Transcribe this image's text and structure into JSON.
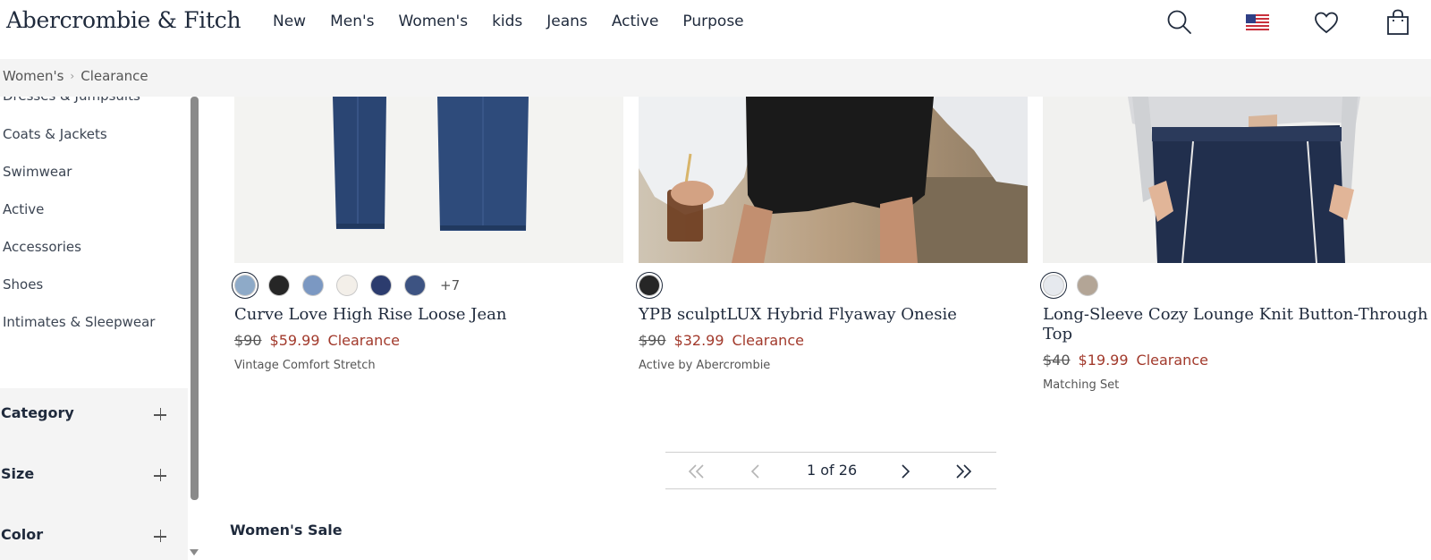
{
  "header": {
    "logo": "Abercrombie & Fitch",
    "nav": [
      "New",
      "Men's",
      "Women's",
      "kids",
      "Jeans",
      "Active",
      "Purpose"
    ],
    "icons": [
      "search-icon",
      "us-flag-icon",
      "wishlist-heart-icon",
      "shopping-bag-icon"
    ]
  },
  "breadcrumb": {
    "items": [
      "Women's",
      "Clearance"
    ],
    "separator": "›"
  },
  "sidebar": {
    "links": [
      "Dresses & Jumpsuits",
      "Coats & Jackets",
      "Swimwear",
      "Active",
      "Accessories",
      "Shoes",
      "Intimates & Sleepwear"
    ],
    "filters": [
      "Category",
      "Size",
      "Color"
    ]
  },
  "products": [
    {
      "name": "Curve Love High Rise Loose Jean",
      "price_original": "$90",
      "price_sale": "$59.99",
      "sale_label": "Clearance",
      "description": "Vintage Comfort Stretch",
      "swatch_colors": [
        "#8eaac8",
        "#262626",
        "#7b98c2",
        "#f3efe9",
        "#2c3c6e",
        "#3d5382"
      ],
      "swatch_more": "+7"
    },
    {
      "name": "YPB sculptLUX Hybrid Flyaway Onesie",
      "price_original": "$90",
      "price_sale": "$32.99",
      "sale_label": "Clearance",
      "description": "Active by Abercrombie",
      "swatch_colors": [
        "#262626"
      ]
    },
    {
      "name": "Long-Sleeve Cozy Lounge Knit Button-Through Top",
      "price_original": "$40",
      "price_sale": "$19.99",
      "sale_label": "Clearance",
      "description": "Matching Set",
      "swatch_colors": [
        "#e6e9ee",
        "#b3a596"
      ]
    }
  ],
  "pagination": {
    "label": "1 of 26",
    "current": 1,
    "total": 26
  },
  "section": {
    "title": "Women's Sale"
  },
  "colors": {
    "navy": "#1f2a3c",
    "clearance_red": "#a23a2c",
    "bar_gray": "#f4f4f4"
  }
}
